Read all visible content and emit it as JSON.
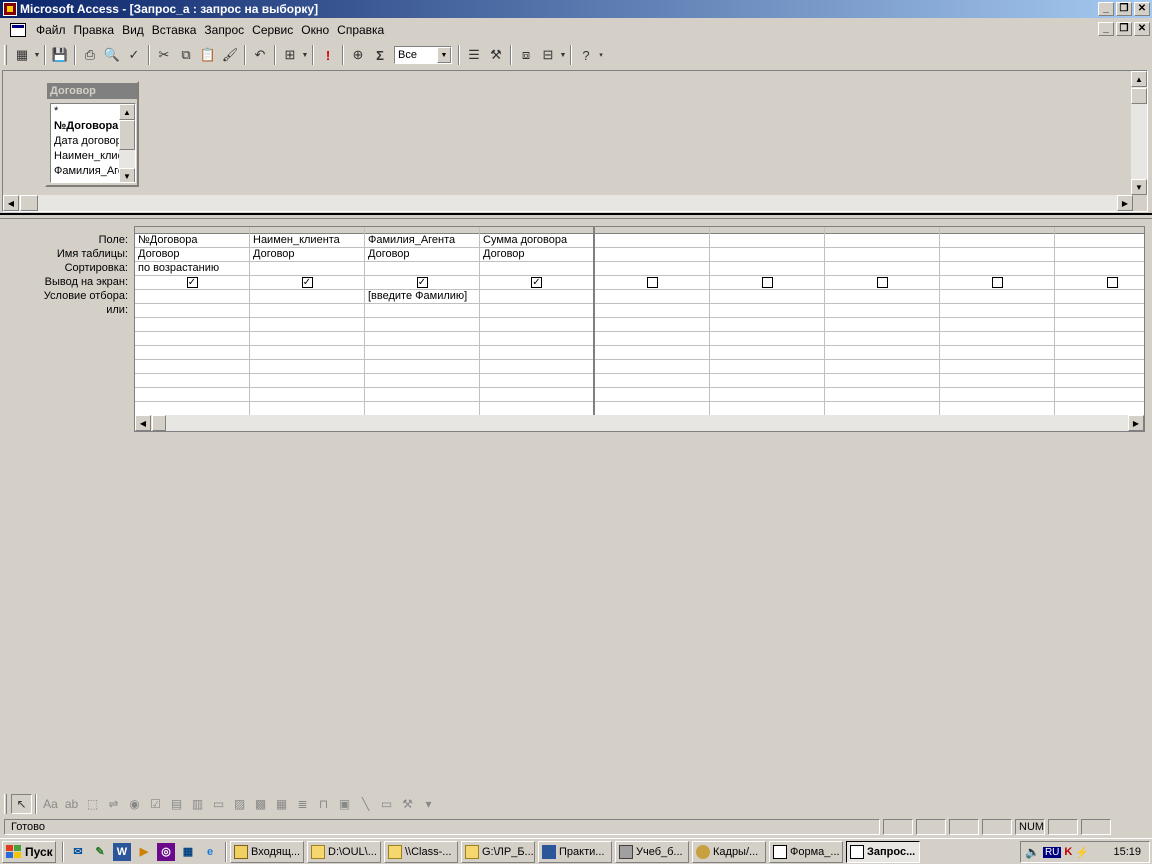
{
  "window": {
    "title": "Microsoft Access - [Запрос_а : запрос на выборку]"
  },
  "menu": {
    "items": [
      "Файл",
      "Правка",
      "Вид",
      "Вставка",
      "Запрос",
      "Сервис",
      "Окно",
      "Справка"
    ]
  },
  "toolbar": {
    "top_values": "Все"
  },
  "table_box": {
    "name": "Договор",
    "fields": [
      {
        "name": "*",
        "key": false
      },
      {
        "name": "№Договора",
        "key": true
      },
      {
        "name": "Дата договора",
        "key": false
      },
      {
        "name": "Наимен_клиента",
        "key": false
      },
      {
        "name": "Фамилия_Агента",
        "key": false
      }
    ]
  },
  "grid": {
    "row_labels": {
      "field": "Поле:",
      "table": "Имя таблицы:",
      "sort": "Сортировка:",
      "show": "Вывод на экран:",
      "criteria": "Условие отбора:",
      "or": "или:"
    },
    "columns": [
      {
        "field": "№Договора",
        "table": "Договор",
        "sort": "по возрастанию",
        "show": true,
        "criteria": ""
      },
      {
        "field": "Наимен_клиента",
        "table": "Договор",
        "sort": "",
        "show": true,
        "criteria": ""
      },
      {
        "field": "Фамилия_Агента",
        "table": "Договор",
        "sort": "",
        "show": true,
        "criteria": "[введите Фамилию]"
      },
      {
        "field": "Сумма договора",
        "table": "Договор",
        "sort": "",
        "show": true,
        "criteria": ""
      },
      {
        "field": "",
        "table": "",
        "sort": "",
        "show": false,
        "criteria": ""
      },
      {
        "field": "",
        "table": "",
        "sort": "",
        "show": false,
        "criteria": ""
      },
      {
        "field": "",
        "table": "",
        "sort": "",
        "show": false,
        "criteria": ""
      },
      {
        "field": "",
        "table": "",
        "sort": "",
        "show": false,
        "criteria": ""
      },
      {
        "field": "",
        "table": "",
        "sort": "",
        "show": false,
        "criteria": ""
      }
    ]
  },
  "status": {
    "text": "Готово",
    "num": "NUM"
  },
  "taskbar": {
    "start": "Пуск",
    "tasks": [
      "Входящ...",
      "D:\\OUL\\...",
      "\\\\Class-...",
      "G:\\ЛР_Б...",
      "Практи...",
      "Учеб_б...",
      "Кадры/...",
      "Форма_...",
      "Запрос..."
    ],
    "lang": "RU",
    "clock": "15:19"
  }
}
